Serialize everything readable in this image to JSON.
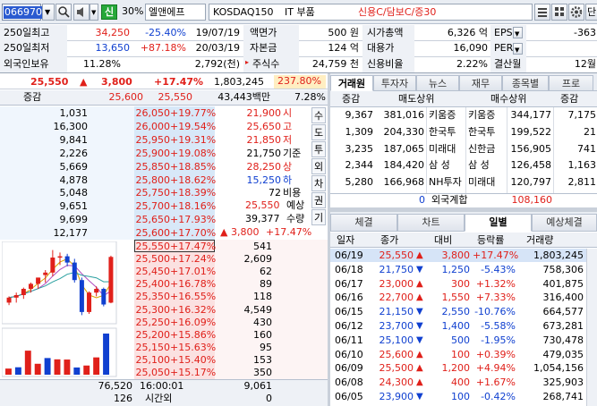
{
  "toolbar": {
    "code": "066970",
    "market_badge": "신",
    "margin": "30%",
    "name": "엘앤에프",
    "index": "KOSDAQ150",
    "sector": "IT 부품",
    "credit": "신용C/담보C/증30"
  },
  "info": {
    "r1": {
      "l1": "250일최고",
      "v1": "34,250",
      "p1": "-25.40%",
      "d1": "19/07/19",
      "l2": "액면가",
      "v2": "500 원",
      "l3": "시가총액",
      "v3": "6,326 억",
      "l4": "EPS",
      "v4": "-363"
    },
    "r2": {
      "l1": "250일최저",
      "v1": "13,650",
      "p1": "+87.18%",
      "d1": "20/03/19",
      "l2": "자본금",
      "v2": "124 억",
      "l3": "대용가",
      "v3": "16,090",
      "l4": "PER",
      "v4": ""
    },
    "r3": {
      "l1": "외국인보유",
      "v1": "11.28%",
      "d1": "2,792(천)",
      "l2": "주식수",
      "v2": "24,759 천",
      "l3": "신용비율",
      "v3": "2.22%",
      "l4": "결산월",
      "v4": "12월"
    }
  },
  "price": {
    "current": "25,550",
    "arrow": "▲",
    "change": "3,800",
    "rate": "+17.47%",
    "volume": "1,803,245",
    "vol_ratio": "237.80%",
    "label": "증감",
    "ask_best": "25,600",
    "bid_best": "25,550",
    "amount": "43,443백만",
    "amount_rate": "7.28%"
  },
  "orderbook": {
    "asks": [
      {
        "q": "1,031",
        "p": "26,050",
        "r": "+19.77%"
      },
      {
        "q": "16,300",
        "p": "26,000",
        "r": "+19.54%"
      },
      {
        "q": "9,841",
        "p": "25,950",
        "r": "+19.31%"
      },
      {
        "q": "2,226",
        "p": "25,900",
        "r": "+19.08%"
      },
      {
        "q": "5,669",
        "p": "25,850",
        "r": "+18.85%"
      },
      {
        "q": "4,878",
        "p": "25,800",
        "r": "+18.62%"
      },
      {
        "q": "5,048",
        "p": "25,750",
        "r": "+18.39%"
      },
      {
        "q": "9,651",
        "p": "25,700",
        "r": "+18.16%"
      },
      {
        "q": "9,699",
        "p": "25,650",
        "r": "+17.93%"
      },
      {
        "q": "12,177",
        "p": "25,600",
        "r": "+17.70%"
      }
    ],
    "bids": [
      {
        "q": "541",
        "p": "25,550",
        "r": "+17.47%"
      },
      {
        "q": "2,609",
        "p": "25,500",
        "r": "+17.24%"
      },
      {
        "q": "62",
        "p": "25,450",
        "r": "+17.01%"
      },
      {
        "q": "89",
        "p": "25,400",
        "r": "+16.78%"
      },
      {
        "q": "118",
        "p": "25,350",
        "r": "+16.55%"
      },
      {
        "q": "4,549",
        "p": "25,300",
        "r": "+16.32%"
      },
      {
        "q": "430",
        "p": "25,250",
        "r": "+16.09%"
      },
      {
        "q": "160",
        "p": "25,200",
        "r": "+15.86%"
      },
      {
        "q": "95",
        "p": "25,150",
        "r": "+15.63%"
      },
      {
        "q": "153",
        "p": "25,100",
        "r": "+15.40%"
      },
      {
        "q": "350",
        "p": "25,050",
        "r": "+15.17%"
      }
    ],
    "info_panel": [
      {
        "v": "21,900",
        "l": "시",
        "c": "red"
      },
      {
        "v": "25,650",
        "l": "고",
        "c": "red"
      },
      {
        "v": "21,850",
        "l": "저",
        "c": "red"
      },
      {
        "v": "21,750",
        "l": "기준",
        "c": "black"
      },
      {
        "v": "28,250",
        "l": "상",
        "c": "red"
      },
      {
        "v": "15,250",
        "l": "하",
        "c": "blue"
      },
      {
        "v": "72",
        "l": "비용",
        "c": "black"
      }
    ],
    "expected_label": "예상",
    "expected_price": "25,550",
    "qty_label": "수량",
    "expected_qty": "39,377",
    "exp_arrow": "▲",
    "exp_change": "3,800",
    "exp_rate": "+17.47%",
    "total_ask": "76,520",
    "total_bid": "9,061",
    "time": "16:00:01",
    "after_label": "시간외",
    "after_ask": "126",
    "after_bid": "0"
  },
  "side_buttons": [
    "수",
    "도",
    "투",
    "외",
    "차",
    "권",
    "기"
  ],
  "broker": {
    "tabs": [
      "거래원",
      "투자자",
      "뉴스",
      "재무",
      "종목별",
      "프로"
    ],
    "headers": [
      "증감",
      "매도상위",
      "매수상위",
      "증감"
    ],
    "rows": [
      {
        "d1": "9,367",
        "s_qty": "381,016",
        "s_name": "키움증",
        "b_name": "키움증",
        "b_qty": "344,177",
        "d2": "7,175"
      },
      {
        "d1": "1,309",
        "s_qty": "204,330",
        "s_name": "한국투",
        "b_name": "한국투",
        "b_qty": "199,522",
        "d2": "21"
      },
      {
        "d1": "3,235",
        "s_qty": "187,065",
        "s_name": "미래대",
        "b_name": "신한금",
        "b_qty": "156,905",
        "d2": "741"
      },
      {
        "d1": "2,344",
        "s_qty": "184,420",
        "s_name": "삼 성",
        "b_name": "삼 성",
        "b_qty": "126,458",
        "d2": "1,163"
      },
      {
        "d1": "5,280",
        "s_qty": "166,968",
        "s_name": "NH투자",
        "b_name": "미래대",
        "b_qty": "120,797",
        "d2": "2,811"
      }
    ],
    "foreign_label": "외국계합",
    "foreign_sell": "0",
    "foreign_buy": "108,160"
  },
  "daily": {
    "tabs": [
      "체결",
      "차트",
      "일별",
      "예상체결"
    ],
    "headers": [
      "일자",
      "종가",
      "대비",
      "등락률",
      "거래량"
    ],
    "rows": [
      {
        "date": "06/19",
        "close": "25,550",
        "dir": "up",
        "chg": "3,800",
        "rate": "+17.47%",
        "vol": "1,803,245"
      },
      {
        "date": "06/18",
        "close": "21,750",
        "dir": "down",
        "chg": "1,250",
        "rate": "-5.43%",
        "vol": "758,306"
      },
      {
        "date": "06/17",
        "close": "23,000",
        "dir": "up",
        "chg": "300",
        "rate": "+1.32%",
        "vol": "401,875"
      },
      {
        "date": "06/16",
        "close": "22,700",
        "dir": "up",
        "chg": "1,550",
        "rate": "+7.33%",
        "vol": "316,400"
      },
      {
        "date": "06/15",
        "close": "21,150",
        "dir": "down",
        "chg": "2,550",
        "rate": "-10.76%",
        "vol": "664,577"
      },
      {
        "date": "06/12",
        "close": "23,700",
        "dir": "down",
        "chg": "1,400",
        "rate": "-5.58%",
        "vol": "673,281"
      },
      {
        "date": "06/11",
        "close": "25,100",
        "dir": "down",
        "chg": "500",
        "rate": "-1.95%",
        "vol": "730,478"
      },
      {
        "date": "06/10",
        "close": "25,600",
        "dir": "up",
        "chg": "100",
        "rate": "+0.39%",
        "vol": "479,035"
      },
      {
        "date": "06/09",
        "close": "25,500",
        "dir": "up",
        "chg": "1,200",
        "rate": "+4.94%",
        "vol": "1,054,156"
      },
      {
        "date": "06/08",
        "close": "24,300",
        "dir": "up",
        "chg": "400",
        "rate": "+1.67%",
        "vol": "325,903"
      },
      {
        "date": "06/05",
        "close": "23,900",
        "dir": "down",
        "chg": "100",
        "rate": "-0.42%",
        "vol": "268,741"
      }
    ]
  },
  "mini_chart": {
    "candles": [
      {
        "o": 21900,
        "h": 22400,
        "l": 21700,
        "c": 22300
      },
      {
        "o": 22300,
        "h": 22700,
        "l": 21900,
        "c": 22500
      },
      {
        "o": 22500,
        "h": 23100,
        "l": 22200,
        "c": 23000
      },
      {
        "o": 23000,
        "h": 23500,
        "l": 22700,
        "c": 23400
      },
      {
        "o": 23400,
        "h": 23900,
        "l": 23000,
        "c": 23900
      },
      {
        "o": 24100,
        "h": 24500,
        "l": 23500,
        "c": 24300
      },
      {
        "o": 24300,
        "h": 26100,
        "l": 24000,
        "c": 25500
      },
      {
        "o": 25500,
        "h": 25900,
        "l": 24900,
        "c": 25600
      },
      {
        "o": 25600,
        "h": 25800,
        "l": 24800,
        "c": 25100
      },
      {
        "o": 25100,
        "h": 25400,
        "l": 23500,
        "c": 23700
      },
      {
        "o": 23700,
        "h": 23900,
        "l": 20900,
        "c": 21150
      },
      {
        "o": 21150,
        "h": 22800,
        "l": 21000,
        "c": 22700
      },
      {
        "o": 22700,
        "h": 23200,
        "l": 22400,
        "c": 23000
      },
      {
        "o": 23000,
        "h": 23100,
        "l": 21600,
        "c": 21750
      },
      {
        "o": 21900,
        "h": 25650,
        "l": 21850,
        "c": 25550
      }
    ],
    "volumes": [
      268741,
      325903,
      1054156,
      479035,
      730478,
      673281,
      664577,
      316400,
      401875,
      758306,
      1803245
    ],
    "colors": {
      "up": "#e0201a",
      "down": "#1040d0"
    }
  }
}
